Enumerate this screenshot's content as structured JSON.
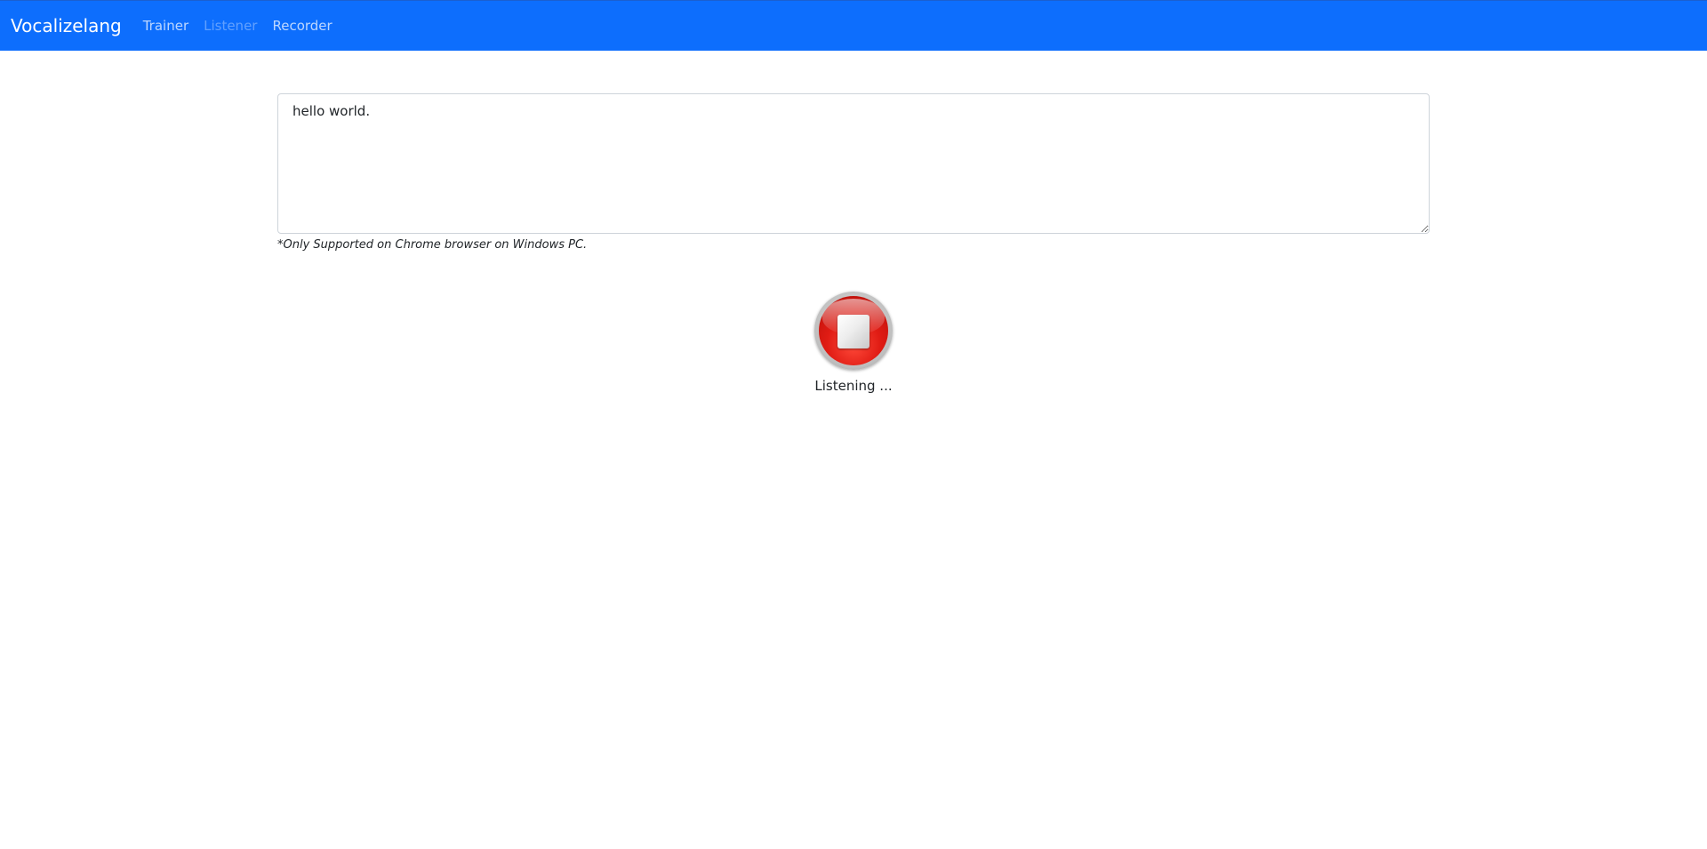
{
  "navbar": {
    "brand": "Vocalizelang",
    "links": [
      {
        "label": "Trainer",
        "state": "normal"
      },
      {
        "label": "Listener",
        "state": "active-disabled"
      },
      {
        "label": "Recorder",
        "state": "normal"
      }
    ],
    "background_color": "#0d6efd"
  },
  "transcript": {
    "value": "hello world."
  },
  "note": {
    "text": "*Only Supported on Chrome browser on Windows PC."
  },
  "record_button": {
    "icon": "stop-icon",
    "color": "#e01c14"
  },
  "status": {
    "text": "Listening ..."
  }
}
